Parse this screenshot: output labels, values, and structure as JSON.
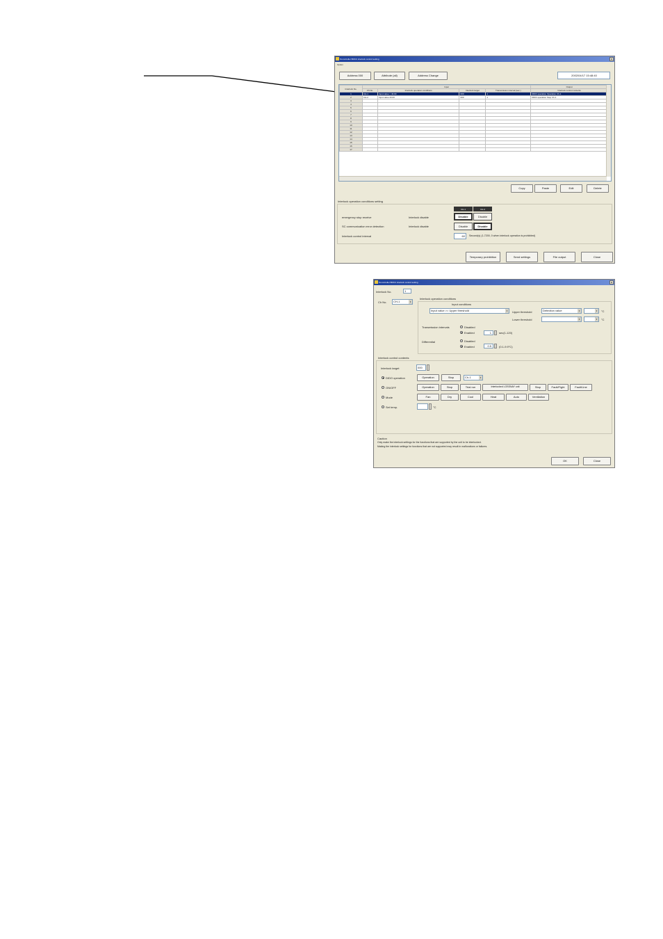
{
  "main_window": {
    "title": "M-controller BDKC interlock control setting",
    "menu": "Option",
    "tabs": [
      "Address 000",
      "Attribute (all)",
      "Address Change"
    ],
    "datetime": "2002/04/17 15:48:40",
    "table": {
      "group_headers": {
        "input": "Input",
        "output": "Output"
      },
      "headers": [
        "Interlock No.",
        "Ch No.",
        "Interlock operation conditions",
        "Interlock target",
        "Transmission interval (sec.)",
        "Interlock control contents"
      ],
      "rows": [
        {
          "no": "1",
          "ch": "CH-1",
          "cond": "Input value > 40.00",
          "target": "000",
          "interval": "1",
          "contents": "DIDO operation Operation Ch-1"
        },
        {
          "no": "2",
          "ch": "CH-2",
          "cond": "Input value 20.00",
          "target": "000",
          "interval": "1",
          "contents": "DIDO operation Stop Ch-1"
        },
        {
          "no": "3"
        },
        {
          "no": "4"
        },
        {
          "no": "5"
        },
        {
          "no": "6"
        },
        {
          "no": "7"
        },
        {
          "no": "8"
        },
        {
          "no": "9"
        },
        {
          "no": "10"
        },
        {
          "no": "11"
        },
        {
          "no": "12"
        },
        {
          "no": "13"
        },
        {
          "no": "14"
        },
        {
          "no": "15"
        },
        {
          "no": "16"
        },
        {
          "no": "17"
        }
      ]
    },
    "row_buttons": {
      "copy": "Copy",
      "paste": "Paste",
      "edit": "Edit",
      "delete": "Delete"
    },
    "conditions": {
      "title": "Interlock operation conditions setting",
      "ch_headers": [
        "CH-1",
        "CH-2"
      ],
      "row1": {
        "label": "emergency stop receive",
        "sub": "Interlock disable",
        "opt1": "Disable",
        "opt2": "Disable"
      },
      "row2": {
        "label": "SC communication error detection",
        "sub": "Interlock disable",
        "opt1": "Disable",
        "opt2": "Disable"
      },
      "row3": {
        "label": "Interlock control interval",
        "value": "60",
        "note": "Second(s) (1-7200, 0 when interlock operation is prohibited)"
      }
    },
    "bottom_buttons": {
      "temp": "Temporary prohibition",
      "send": "Send settings",
      "file": "File output",
      "close": "Close"
    }
  },
  "edit_dialog": {
    "title": "M-controller BDKC interlock control setting",
    "interlock_no_label": "Interlock No.",
    "interlock_no_value": "1",
    "ch_label": "Ch No.",
    "ch_value": "CH-1",
    "op_cond": {
      "group": "Interlock operation conditions",
      "input_conditions": "Input conditions",
      "input_select": "Input value >= Upper threshold",
      "upper_label": "Upper threshold",
      "upper_select": "Detection value",
      "upper_unit": "°C",
      "lower_label": "Lower threshold",
      "lower_unit": "°C",
      "trans_label": "Transmission intervals",
      "trans_disabled": "Disabled",
      "trans_enabled": "Enabled",
      "trans_value": "1",
      "trans_note": "sec(1-120)",
      "diff_label": "Differential",
      "diff_disabled": "Disabled",
      "diff_enabled": "Enabled",
      "diff_value": "0.5",
      "diff_note": "(0.1-9.9°C)"
    },
    "control": {
      "group": "Interlock control contents",
      "target_label": "Interlock target",
      "target_value": "000",
      "dido_label": "DIDO operation",
      "dido_buttons": [
        "Operation",
        "Stop"
      ],
      "dido_ch": "Ch-1",
      "onoff_label": "ON/OFF",
      "onoff_buttons": [
        "Operation",
        "Stop",
        "Trial run",
        "Interlocked LOSSNAY unit",
        "Stop",
        "Fault/Fight",
        "Fault/Line"
      ],
      "mode_label": "Mode",
      "mode_buttons": [
        "Fan",
        "Dry",
        "Cool",
        "Heat",
        "Auto",
        "Ventilation"
      ],
      "temp_label": "Set temp.",
      "temp_unit": "°C"
    },
    "caution": {
      "title": "Caution",
      "line1": "Only make the interlock settings for the functions that are supported by the unit to be interlocked.",
      "line2": "Making the interlock settings for functions that are not supported may result in malfunctions or failures."
    },
    "ok": "OK",
    "close": "Close"
  },
  "colors": {
    "selection": "#0a246a",
    "titlebar": "#1c3f9c",
    "window": "#ece9d8"
  }
}
